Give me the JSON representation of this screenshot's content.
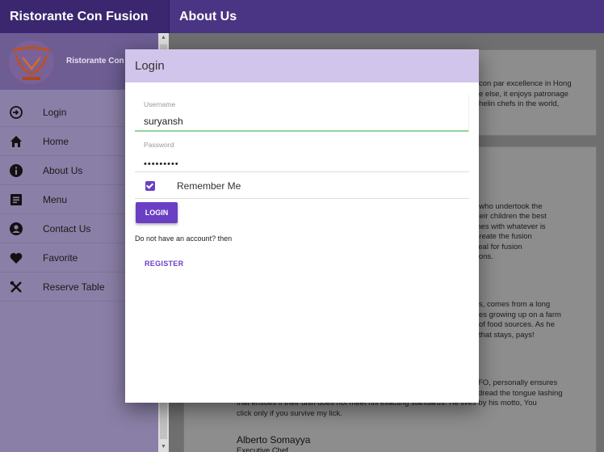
{
  "topbar": {
    "brand": "Ristorante Con Fusion",
    "page_title": "About Us"
  },
  "sidebar": {
    "brand": "Ristorante Con F",
    "items": [
      {
        "label": "Login",
        "icon": "login-icon"
      },
      {
        "label": "Home",
        "icon": "home-icon"
      },
      {
        "label": "About Us",
        "icon": "info-icon"
      },
      {
        "label": "Menu",
        "icon": "menu-list-icon"
      },
      {
        "label": "Contact Us",
        "icon": "account-circle-icon"
      },
      {
        "label": "Favorite",
        "icon": "heart-icon"
      },
      {
        "label": "Reserve Table",
        "icon": "utensils-icon"
      }
    ]
  },
  "background_text": {
    "p1": [
      "con par excellence in Hong",
      "e else, it enjoys patronage",
      "helin chefs in the world,"
    ],
    "p2": [
      "nts who undertook the",
      "g their children the best",
      "dishes with whatever is",
      "to create the fusion",
      "is zeal for fusion",
      "ections."
    ],
    "p3": [
      "s, comes from a long",
      "es growing up on a farm",
      "of food sources. As he",
      "that stays, pays!"
    ],
    "p4": [
      "FO, personally ensures",
      "dread the tongue lashing",
      "that ensues if their dish does not meet his exacting standards. He lives by his motto, You",
      "click only if you survive my lick."
    ],
    "name": "Alberto Somayya",
    "role": "Executive Chef"
  },
  "dialog": {
    "title": "Login",
    "username": {
      "label": "Username",
      "value": "suryansh"
    },
    "password": {
      "label": "Password",
      "value": "•••••••••"
    },
    "remember_label": "Remember Me",
    "remember_checked": true,
    "login_button": "LOGIN",
    "no_account_text": "Do not have an account? then",
    "register_button": "REGISTER"
  },
  "colors": {
    "header": "#3a2770",
    "dialog_header": "#d2c5eb",
    "accent": "#6a3fc4",
    "focus_underline": "#8fd69b"
  }
}
